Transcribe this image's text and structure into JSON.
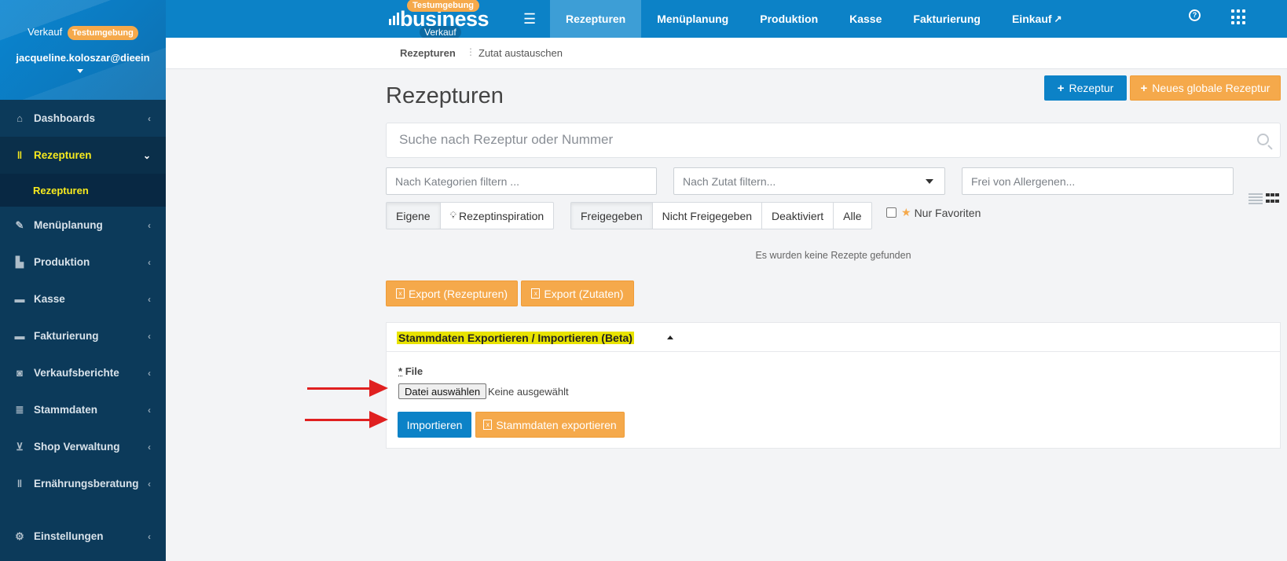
{
  "sidebar": {
    "verkauf_label": "Verkauf",
    "env_badge": "Testumgebung",
    "user_email": "jacqueline.koloszar@dieein",
    "items": [
      {
        "label": "Dashboards",
        "icon": "home-icon"
      },
      {
        "label": "Rezepturen",
        "icon": "cutlery-icon",
        "active": true
      },
      {
        "label": "Menüplanung",
        "icon": "edit-icon"
      },
      {
        "label": "Produktion",
        "icon": "factory-icon"
      },
      {
        "label": "Kasse",
        "icon": "card-icon"
      },
      {
        "label": "Fakturierung",
        "icon": "card-icon"
      },
      {
        "label": "Verkaufsberichte",
        "icon": "money-icon"
      },
      {
        "label": "Stammdaten",
        "icon": "database-icon"
      },
      {
        "label": "Shop Verwaltung",
        "icon": "basket-icon"
      },
      {
        "label": "Ernährungsberatung",
        "icon": "cutlery-icon"
      },
      {
        "label": "Einstellungen",
        "icon": "gear-icon"
      }
    ],
    "sub_item": "Rezepturen"
  },
  "topbar": {
    "logo_word": "business",
    "logo_badge": "Testumgebung",
    "logo_sub": "Verkauf",
    "nav": [
      "Rezepturen",
      "Menüplanung",
      "Produktion",
      "Kasse",
      "Fakturierung",
      "Einkauf"
    ]
  },
  "breadcrumb": {
    "current": "Rezepturen",
    "action": "Zutat austauschen"
  },
  "main": {
    "title": "Rezepturen",
    "add_button": "Rezeptur",
    "add_global_button": "Neues globale Rezeptur",
    "search_placeholder": "Suche nach Rezeptur oder Nummer",
    "filter_category_placeholder": "Nach Kategorien filtern ...",
    "filter_ingredient_placeholder": "Nach Zutat filtern...",
    "filter_allergen_placeholder": "Frei von Allergenen...",
    "source_tabs": [
      "Eigene",
      "Rezeptinspiration"
    ],
    "status_tabs": [
      "Freigegeben",
      "Nicht Freigegeben",
      "Deaktiviert",
      "Alle"
    ],
    "favorites_label": "Nur Favoriten",
    "empty_message": "Es wurden keine Rezepte gefunden",
    "export_recipes": "Export (Rezepturen)",
    "export_ingredients": "Export (Zutaten)"
  },
  "panel": {
    "title": "Stammdaten Exportieren / Importieren (Beta)",
    "file_label_req": "*",
    "file_label": "File",
    "choose_file": "Datei auswählen",
    "no_file": "Keine ausgewählt",
    "import_button": "Importieren",
    "export_button": "Stammdaten exportieren"
  },
  "colors": {
    "primary": "#0c82c7",
    "sidebar": "#0c3a5a",
    "orange": "#f5a94b",
    "highlight": "#e8e300",
    "annotation_arrow": "#e02020"
  }
}
